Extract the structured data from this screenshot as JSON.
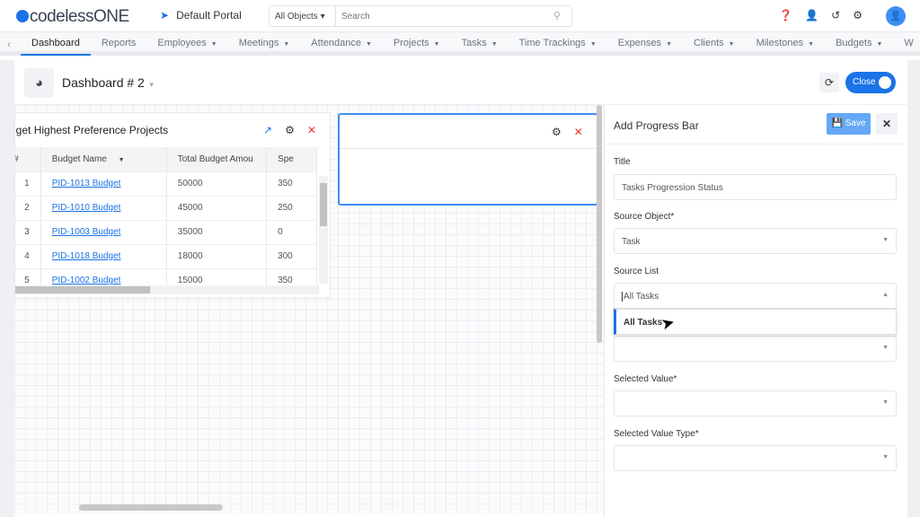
{
  "app": {
    "logo": "codelessONE",
    "portal": "Default Portal"
  },
  "search": {
    "scope": "All Objects",
    "placeholder": "Search"
  },
  "nav": {
    "items": [
      {
        "label": "Dashboard",
        "active": true,
        "dropdown": false
      },
      {
        "label": "Reports",
        "dropdown": false
      },
      {
        "label": "Employees",
        "dropdown": true
      },
      {
        "label": "Meetings",
        "dropdown": true
      },
      {
        "label": "Attendance",
        "dropdown": true
      },
      {
        "label": "Projects",
        "dropdown": true
      },
      {
        "label": "Tasks",
        "dropdown": true
      },
      {
        "label": "Time Trackings",
        "dropdown": true
      },
      {
        "label": "Expenses",
        "dropdown": true
      },
      {
        "label": "Clients",
        "dropdown": true
      },
      {
        "label": "Milestones",
        "dropdown": true
      },
      {
        "label": "Budgets",
        "dropdown": true
      },
      {
        "label": "W",
        "dropdown": false
      }
    ]
  },
  "dashboard": {
    "title": "Dashboard # 2",
    "toggle_label": "Close",
    "toggle_on": true
  },
  "widget1": {
    "title": "dget Highest Preference Projects",
    "columns": [
      "#",
      "Budget Name",
      "Total Budget Amou",
      "Spe"
    ],
    "rows": [
      [
        "1",
        "PID-1013 Budget",
        "50000",
        "350"
      ],
      [
        "2",
        "PID-1010 Budget",
        "45000",
        "250"
      ],
      [
        "3",
        "PID-1003 Budget",
        "35000",
        "0"
      ],
      [
        "4",
        "PID-1018 Budget",
        "18000",
        "300"
      ],
      [
        "5",
        "PID-1002 Budget",
        "15000",
        "350"
      ]
    ]
  },
  "panel": {
    "title": "Add Progress Bar",
    "save": "Save",
    "fields": {
      "title_label": "Title",
      "title_value": "Tasks Progression Status",
      "source_object_label": "Source Object*",
      "source_object_value": "Task",
      "source_list_label": "Source List",
      "source_list_value": "All Tasks",
      "source_list_option": "All Tasks",
      "selected_value_label": "Selected Value*",
      "selected_value_type_label": "Selected Value Type*"
    }
  },
  "colors": {
    "accent": "#1a73e8",
    "danger": "#e53935"
  }
}
